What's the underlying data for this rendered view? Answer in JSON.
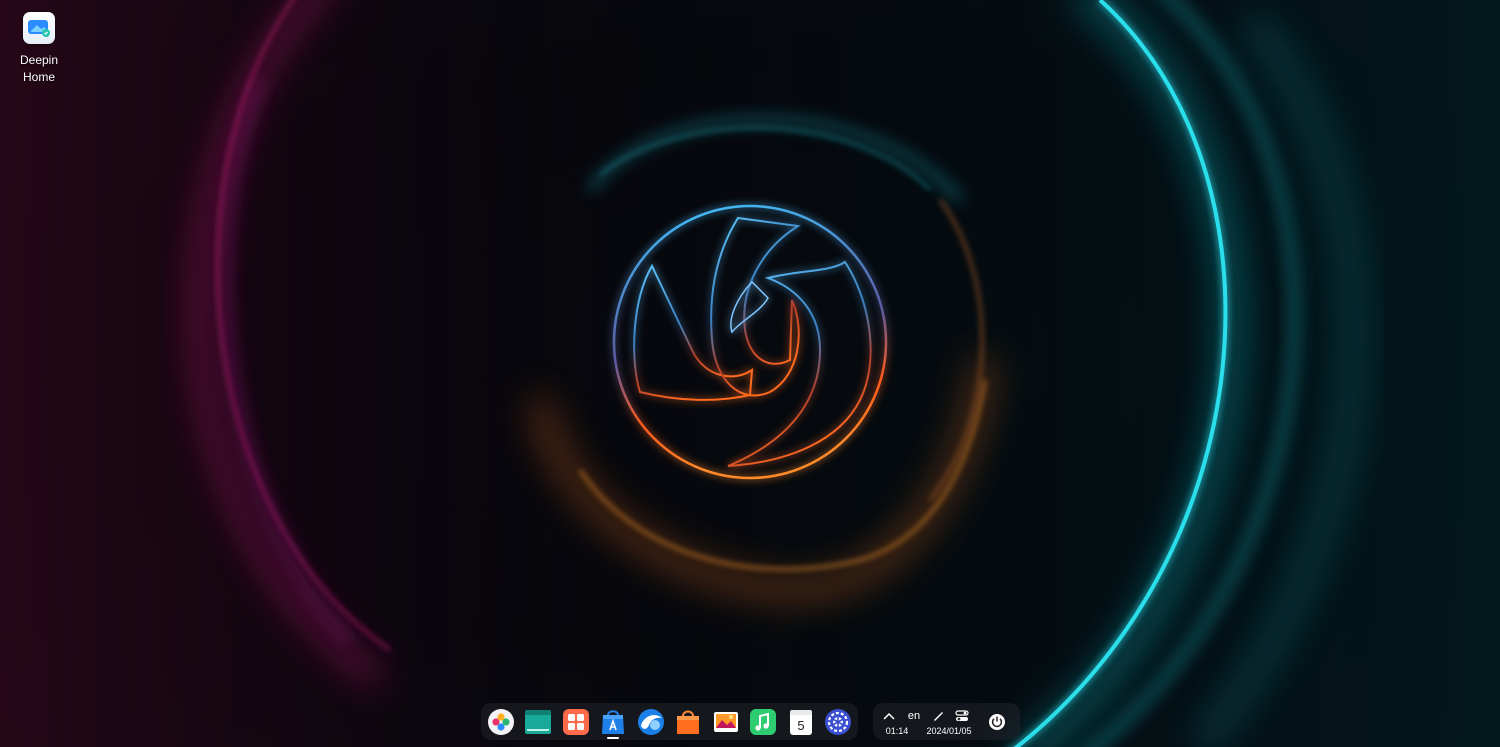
{
  "desktop": {
    "icons": [
      {
        "label": "Deepin\nHome",
        "icon": "deepin-home-icon"
      }
    ]
  },
  "dock": {
    "apps": [
      {
        "name": "launcher",
        "icon": "launcher-icon"
      },
      {
        "name": "terminal",
        "icon": "terminal-icon"
      },
      {
        "name": "multitasking",
        "icon": "multitasking-icon"
      },
      {
        "name": "app-store",
        "icon": "app-store-icon",
        "running": true
      },
      {
        "name": "browser",
        "icon": "browser-icon"
      },
      {
        "name": "file-manager",
        "icon": "file-manager-icon"
      },
      {
        "name": "image-viewer",
        "icon": "image-viewer-icon"
      },
      {
        "name": "music",
        "icon": "music-icon"
      },
      {
        "name": "calendar",
        "icon": "calendar-icon",
        "day": "5"
      },
      {
        "name": "control-center",
        "icon": "settings-icon"
      }
    ],
    "tray": {
      "expand_icon": "chevron-up-icon",
      "language": "en",
      "time": "01:14",
      "date": "2024/01/05",
      "pen_icon": "pen-icon",
      "toggles_icon": "control-toggles-icon",
      "power_icon": "power-icon"
    }
  },
  "colors": {
    "accent_cyan": "#19d8e6",
    "accent_orange": "#ff6a1f",
    "accent_magenta": "#d01a78",
    "background": "#04060a"
  }
}
